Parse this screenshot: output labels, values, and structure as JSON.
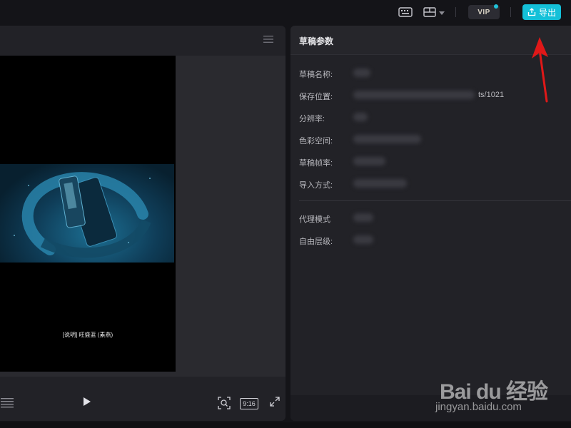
{
  "topbar": {
    "vip_label": "VIP",
    "export_label": "导出",
    "accent_color": "#14c0d8"
  },
  "player": {
    "subtitle": "[说明] 旺盛蓝 (素燕)",
    "ratio_label": "9:16"
  },
  "params": {
    "title": "草稿参数",
    "rows": [
      {
        "label": "草稿名称:"
      },
      {
        "label": "保存位置:",
        "visible_tail": "ts/1021"
      },
      {
        "label": "分辨率:"
      },
      {
        "label": "色彩空间:"
      },
      {
        "label": "草稿帧率:"
      },
      {
        "label": "导入方式:"
      }
    ],
    "rows2": [
      {
        "label": "代理模式"
      },
      {
        "label": "自由层级:"
      }
    ]
  },
  "watermark": {
    "logo": "Bai du 经验",
    "url": "jingyan.baidu.com"
  },
  "icons": [
    "keyboard-icon",
    "layout-icon",
    "chevron-down-icon",
    "export-icon",
    "menu-icon",
    "play-icon",
    "zoom-fit-icon",
    "fullscreen-icon",
    "list-icon"
  ]
}
